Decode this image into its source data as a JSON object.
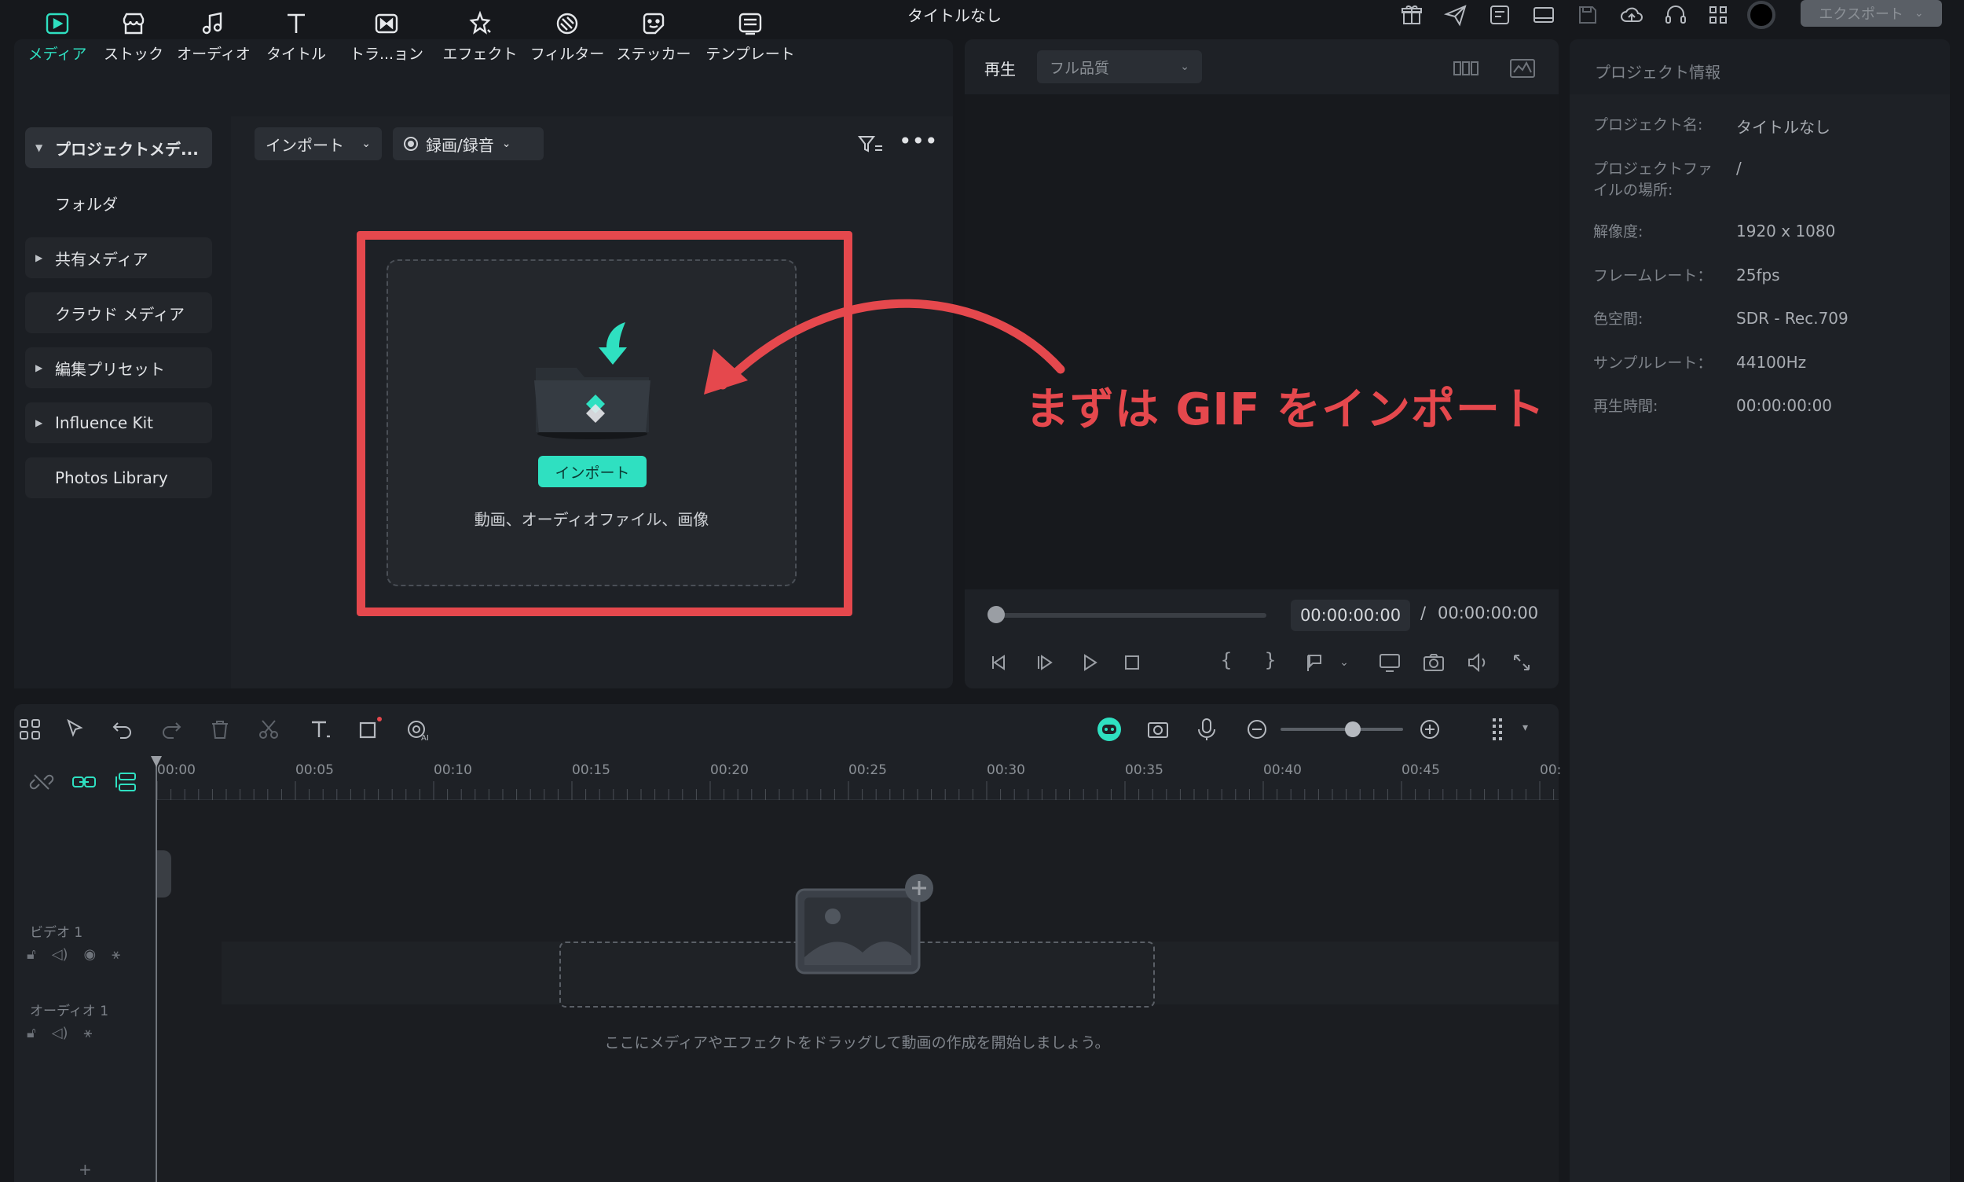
{
  "window": {
    "title": "タイトルなし",
    "export_label": "エクスポート"
  },
  "media_tabs": [
    {
      "label": "メディア",
      "icon": "media-icon"
    },
    {
      "label": "ストック",
      "icon": "stock-icon"
    },
    {
      "label": "オーディオ",
      "icon": "audio-icon"
    },
    {
      "label": "タイトル",
      "icon": "title-icon"
    },
    {
      "label": "トラ...ョン",
      "icon": "transition-icon"
    },
    {
      "label": "エフェクト",
      "icon": "effect-icon"
    },
    {
      "label": "フィルター",
      "icon": "filter-icon"
    },
    {
      "label": "ステッカー",
      "icon": "sticker-icon"
    },
    {
      "label": "テンプレート",
      "icon": "template-icon"
    }
  ],
  "sidebar": {
    "items": [
      {
        "label": "プロジェクトメデ..."
      },
      {
        "label": "フォルダ"
      },
      {
        "label": "共有メディア"
      },
      {
        "label": "クラウド メディア"
      },
      {
        "label": "編集プリセット"
      },
      {
        "label": "Influence Kit"
      },
      {
        "label": "Photos Library"
      }
    ]
  },
  "media_toolbar": {
    "import_label": "インポート",
    "record_label": "録画/録音"
  },
  "drop_zone": {
    "button_label": "インポート",
    "hint": "動画、オーディオファイル、画像"
  },
  "annotation": {
    "text": "まずは GIF をインポート",
    "color": "#e5484d"
  },
  "player": {
    "play_label": "再生",
    "quality": "フル品質",
    "time_current": "00:00:00:00",
    "time_separator": "/",
    "time_total": "00:00:00:00",
    "progress": 0
  },
  "project_info": {
    "title": "プロジェクト情報",
    "rows": [
      {
        "label": "プロジェクト名:",
        "value": "タイトルなし"
      },
      {
        "label": "プロジェクトファイルの場所:",
        "value": "/"
      },
      {
        "label": "解像度:",
        "value": "1920 x 1080"
      },
      {
        "label": "フレームレート：",
        "value": "25fps"
      },
      {
        "label": "色空間:",
        "value": "SDR - Rec.709"
      },
      {
        "label": "サンプルレート：",
        "value": "44100Hz"
      },
      {
        "label": "再生時間:",
        "value": "00:00:00:00"
      }
    ]
  },
  "timeline": {
    "ticks": [
      "00:00",
      "00:05",
      "00:10",
      "00:15",
      "00:20",
      "00:25",
      "00:30",
      "00:35",
      "00:40",
      "00:45",
      "00:"
    ],
    "tracks": [
      {
        "name": "ビデオ 1"
      },
      {
        "name": "オーディオ 1"
      }
    ],
    "hint": "ここにメディアやエフェクトをドラッグして動画の作成を開始しましょう。",
    "zoom_level": 0.55,
    "add_track": "+"
  },
  "colors": {
    "accent": "#2fe0c1",
    "annotation_red": "#e5484d"
  }
}
